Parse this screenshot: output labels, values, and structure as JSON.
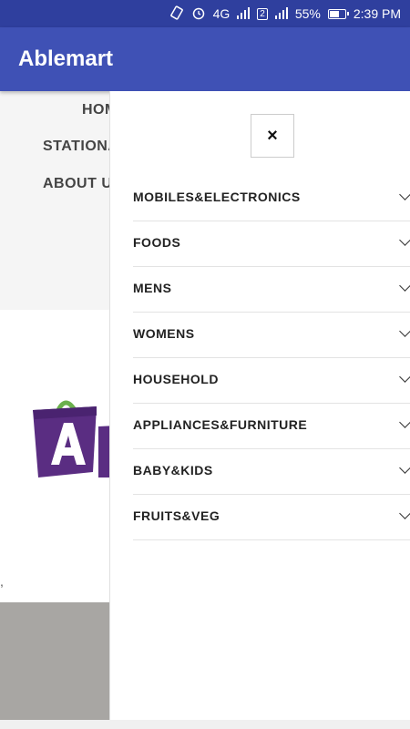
{
  "status_bar": {
    "signal_label": "4G",
    "sim_badge": "2",
    "battery": "55%",
    "time": "2:39 PM",
    "battery_level": 0.55
  },
  "app_bar": {
    "title": "Ablemart"
  },
  "background_nav": {
    "home": "HOM",
    "stationery": "STATIONA",
    "about": "ABOUT U"
  },
  "background": {
    "comma": ","
  },
  "drawer": {
    "close_icon": "×",
    "categories": [
      {
        "label": "MOBILES&ELECTRONICS"
      },
      {
        "label": "FOODS"
      },
      {
        "label": "MENS"
      },
      {
        "label": "WOMENS"
      },
      {
        "label": "HOUSEHOLD"
      },
      {
        "label": "APPLIANCES&FURNITURE"
      },
      {
        "label": "BABY&KIDS"
      },
      {
        "label": "FRUITS&VEG"
      }
    ]
  },
  "colors": {
    "status_bar": "#2f3f9e",
    "app_bar": "#3f51b5",
    "logo_purple": "#5a2d82",
    "logo_green": "#6ab04c"
  }
}
